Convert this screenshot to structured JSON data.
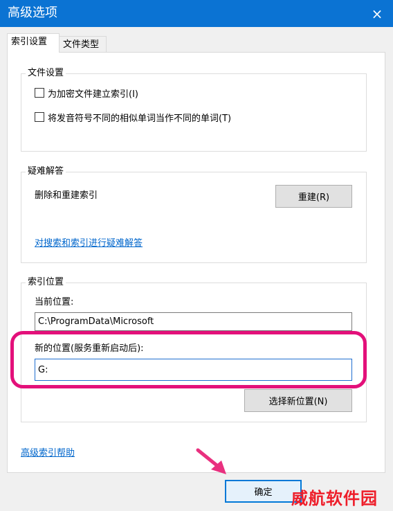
{
  "window": {
    "title": "高级选项",
    "close_icon": "×"
  },
  "tabs": [
    {
      "label": "索引设置",
      "active": true
    },
    {
      "label": "文件类型",
      "active": false
    }
  ],
  "file_settings": {
    "title": "文件设置",
    "options": [
      {
        "label": "为加密文件建立索引(I)",
        "checked": false
      },
      {
        "label": "将发音符号不同的相似单词当作不同的单词(T)",
        "checked": false
      }
    ]
  },
  "troubleshoot": {
    "title": "疑难解答",
    "rebuild_desc": "删除和重建索引",
    "rebuild_button": "重建(R)",
    "troubleshoot_link": "对搜索和索引进行疑难解答"
  },
  "index_location": {
    "title": "索引位置",
    "current_label": "当前位置:",
    "current_value": "C:\\ProgramData\\Microsoft",
    "new_label": "新的位置(服务重新启动后):",
    "new_value": "G:",
    "select_button": "选择新位置(N)"
  },
  "footer": {
    "help_link": "高级索引帮助",
    "ok_button": "确定"
  },
  "watermark": "威航软件园",
  "colors": {
    "titlebar": "#0b73d3",
    "highlight": "#e3107a",
    "arrow": "#e9307f",
    "watermark": "#ee1e2a",
    "link": "#0066cc"
  }
}
